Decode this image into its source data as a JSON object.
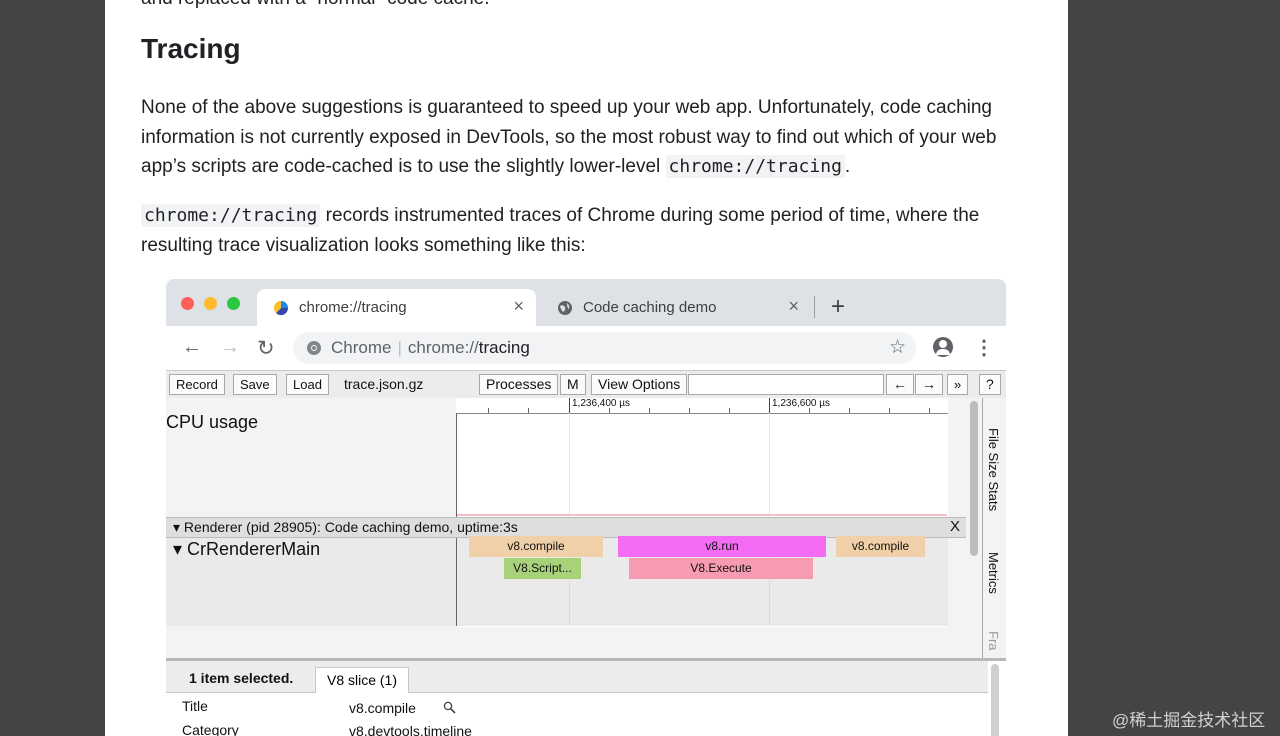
{
  "article": {
    "prev_line": "and replaced with a “normal” code cache.",
    "heading": "Tracing",
    "p1_text": "None of the above suggestions is guaranteed to speed up your web app. Unfortunately, code caching information is not currently exposed in DevTools, so the most robust way to find out which of your web app’s scripts are code-cached is to use the slightly lower-level ",
    "p1_code": "chrome://tracing",
    "p1_end": ".",
    "p2_code": "chrome://tracing",
    "p2_text": " records instrumented traces of Chrome during some period of time, where the resulting trace visualization looks something like this:"
  },
  "browser": {
    "tab_active_label": "chrome://tracing",
    "tab_inactive_label": "Code caching demo",
    "close_glyph": "×",
    "new_tab_glyph": "+",
    "back_glyph": "←",
    "forward_glyph": "→",
    "reload_glyph": "↻",
    "omnibox_site": "Chrome",
    "omnibox_sep": "|",
    "omnibox_url_prefix": "chrome://",
    "omnibox_url_path": "tracing",
    "star_glyph": "☆",
    "menu_glyph": "⋮"
  },
  "tracing": {
    "record": "Record",
    "save": "Save",
    "load": "Load",
    "filename": "trace.json.gz",
    "processes": "Processes",
    "m": "M",
    "view_options": "View Options",
    "search_value": "",
    "prev": "←",
    "next": "→",
    "more": "»",
    "help": "?",
    "ruler_labels": [
      "1,236,400 µs",
      "1,236,600 µs"
    ],
    "cpu_label": "CPU usage",
    "process_header": "Renderer (pid 28905): Code caching demo, uptime:3s",
    "process_close": "X",
    "thread_label": "CrRendererMain",
    "slices": [
      {
        "label": "v8.compile",
        "color": "#f0d0a8"
      },
      {
        "label": "V8.Script...",
        "color": "#a8d27a"
      },
      {
        "label": "v8.run",
        "color": "#f36cf3"
      },
      {
        "label": "V8.Execute",
        "color": "#f79bb2"
      },
      {
        "label": "v8.compile",
        "color": "#f0d0a8"
      }
    ],
    "side_tabs": [
      "File Size Stats",
      "Metrics",
      "Fra"
    ],
    "analysis": {
      "selection": "1 item selected.",
      "tab": "V8 slice (1)",
      "rows": [
        {
          "key": "Title",
          "value": "v8.compile"
        },
        {
          "key": "Category",
          "value": "v8,devtools.timeline"
        }
      ]
    }
  },
  "watermark": "@稀土掘金技术社区"
}
